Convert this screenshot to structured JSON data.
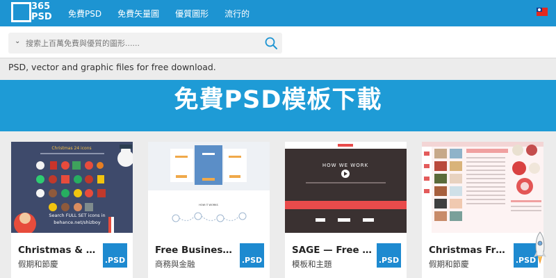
{
  "logo": {
    "number": "365",
    "text": "PSD"
  },
  "nav": [
    "免費PSD",
    "免費矢量圖",
    "優質圖形",
    "流行的"
  ],
  "search": {
    "placeholder": "搜索上百萬免費與優質的圖形......"
  },
  "tagline": "PSD, vector and graphic files for free download.",
  "hero_title": "免費PSD模板下載",
  "cards": [
    {
      "title": "Christmas & N…",
      "category": "假期和節慶",
      "badge": ".PSD",
      "thumb": {
        "heading": "Christmas 24 icons",
        "cta_line1": "Search FULL SET icons in",
        "cta_line2": "behance.net/shizboy"
      }
    },
    {
      "title": "Free Business …",
      "category": "商務與金融",
      "badge": ".PSD",
      "thumb": {
        "section": "HOW IT WORKS"
      }
    },
    {
      "title": "SAGE — Free …",
      "category": "模板和主題",
      "badge": ".PSD",
      "thumb": {
        "heading": "HOW WE WORK"
      }
    },
    {
      "title": "Christmas Fre…",
      "category": "假期和節慶",
      "badge": ".PSD",
      "thumb": {}
    }
  ],
  "colors": {
    "brand_blue": "#1d94d2",
    "hero_blue": "#1e9bd6",
    "badge_blue": "#1e8ad0"
  },
  "icons": [
    "search-icon",
    "chevron-down-icon",
    "taiwan-flag-icon",
    "rocket-icon"
  ]
}
